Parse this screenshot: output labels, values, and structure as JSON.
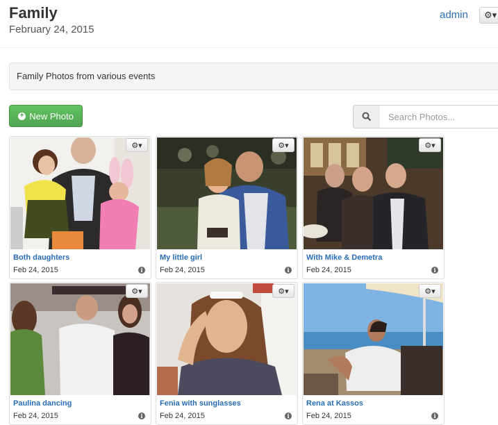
{
  "header": {
    "title": "Family",
    "date": "February 24, 2015",
    "user": "admin",
    "settings_icon": "gear-icon"
  },
  "album": {
    "description": "Family Photos from various events"
  },
  "toolbar": {
    "new_photo_label": "New Photo",
    "search_placeholder": "Search Photos..."
  },
  "photos": [
    {
      "caption": "Both daughters",
      "date": "Feb 24, 2015"
    },
    {
      "caption": "My little girl",
      "date": "Feb 24, 2015"
    },
    {
      "caption": "With Mike & Demetra",
      "date": "Feb 24, 2015"
    },
    {
      "caption": "Paulina dancing",
      "date": "Feb 24, 2015"
    },
    {
      "caption": "Fenia with sunglasses",
      "date": "Feb 24, 2015"
    },
    {
      "caption": "Rena at Kassos",
      "date": "Feb 24, 2015"
    }
  ],
  "colors": {
    "link": "#2a6db5",
    "success": "#51a351"
  }
}
